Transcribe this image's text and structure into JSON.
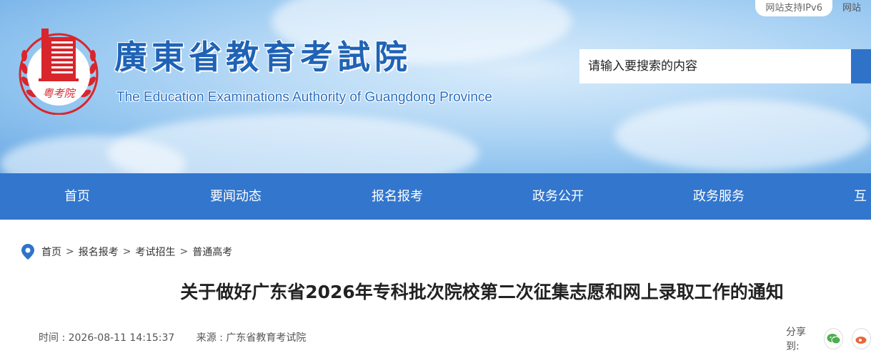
{
  "header": {
    "top_links": [
      "网站支持IPv6",
      "网站"
    ],
    "title_zh": "廣東省教育考試院",
    "title_en": "The Education Examinations Authority of Guangdong Province",
    "emblem_text": "粤考院",
    "search_placeholder": "请输入要搜索的内容"
  },
  "nav": {
    "items": [
      "首页",
      "要闻动态",
      "报名报考",
      "政务公开",
      "政务服务",
      "互"
    ]
  },
  "breadcrumb": {
    "items": [
      "首页",
      "报名报考",
      "考试招生",
      "普通高考"
    ],
    "separator": ">"
  },
  "article": {
    "title": "关于做好广东省2026年专科批次院校第二次征集志愿和网上录取工作的通知",
    "time_label": "时间 : 2026-08-11 14:15:37",
    "source_label": "来源 : 广东省教育考试院",
    "share_label": "分享到:"
  },
  "colors": {
    "nav_bg": "#3276cd",
    "brand_blue": "#1f63b6",
    "emblem_red": "#d8262c",
    "wechat_green": "#4caf50",
    "weibo_orange": "#e8663a"
  }
}
